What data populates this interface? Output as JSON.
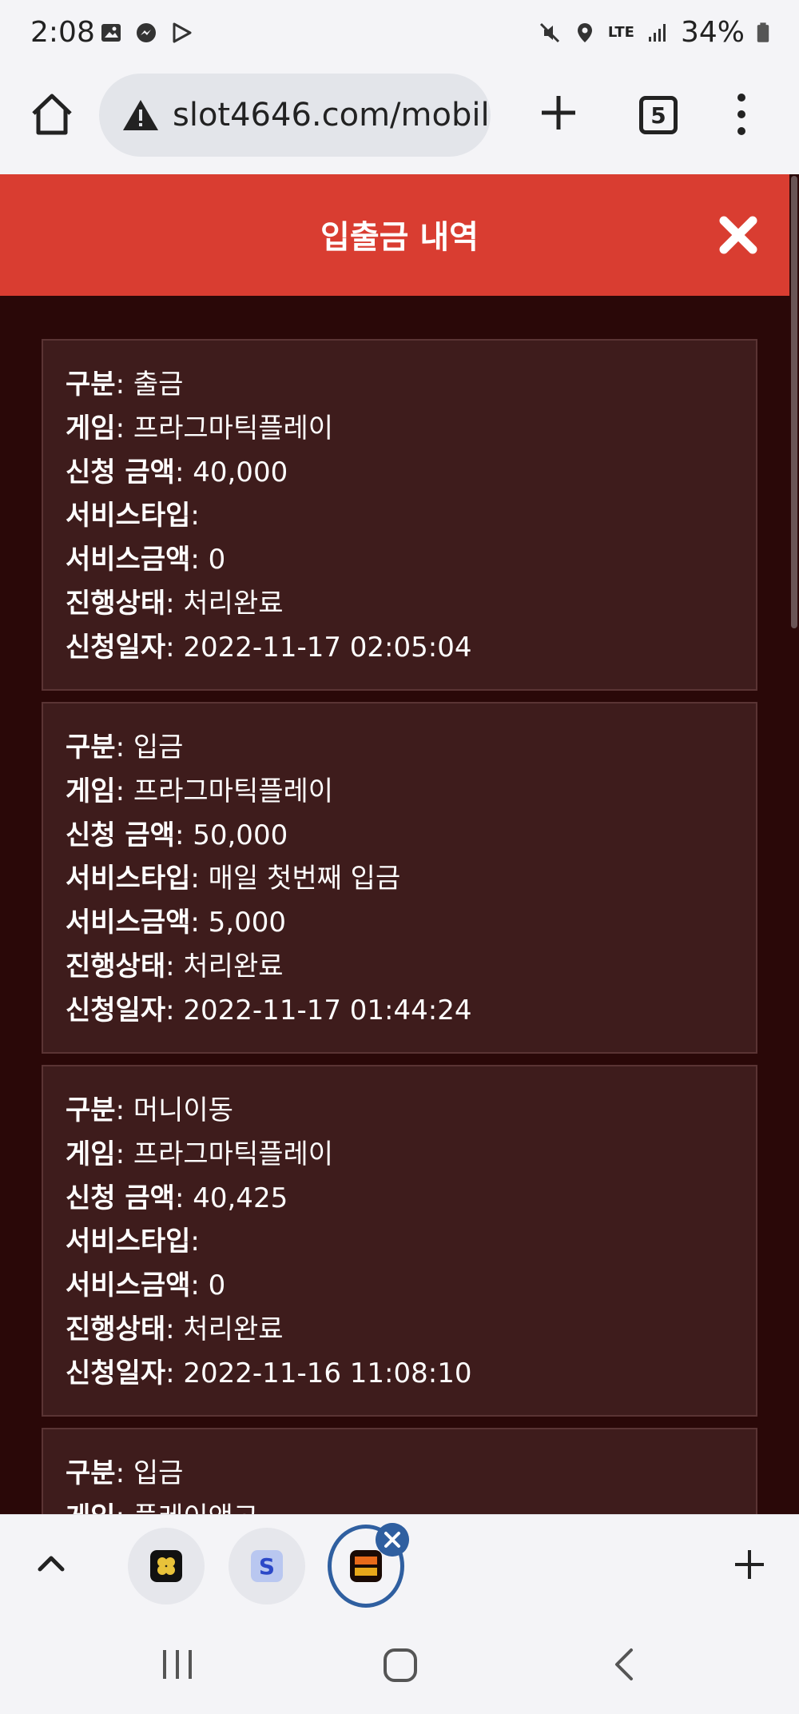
{
  "status_bar": {
    "time": "2:08",
    "battery": "34%",
    "network": "LTE"
  },
  "browser": {
    "url": "slot4646.com/mobil",
    "tab_count": "5"
  },
  "page": {
    "title": "입출금 내역"
  },
  "labels": {
    "type": "구분",
    "game": "게임",
    "amount": "신청 금액",
    "service_type": "서비스타입",
    "service_amount": "서비스금액",
    "status": "진행상태",
    "date": "신청일자"
  },
  "records": [
    {
      "type": "출금",
      "game": "프라그마틱플레이",
      "amount": "40,000",
      "service_type": "",
      "service_amount": "0",
      "status": "처리완료",
      "date": "2022-11-17 02:05:04"
    },
    {
      "type": "입금",
      "game": "프라그마틱플레이",
      "amount": "50,000",
      "service_type": "매일 첫번째 입금",
      "service_amount": "5,000",
      "status": "처리완료",
      "date": "2022-11-17 01:44:24"
    },
    {
      "type": "머니이동",
      "game": "프라그마틱플레이",
      "amount": "40,425",
      "service_type": "",
      "service_amount": "0",
      "status": "처리완료",
      "date": "2022-11-16 11:08:10"
    },
    {
      "type": "입금",
      "game": "플레이앤고"
    }
  ],
  "colors": {
    "header": "#d93d31",
    "page_bg": "#2a0808",
    "card_bg": "#3e1c1c",
    "tab_active_ring": "#2f5fa0"
  }
}
